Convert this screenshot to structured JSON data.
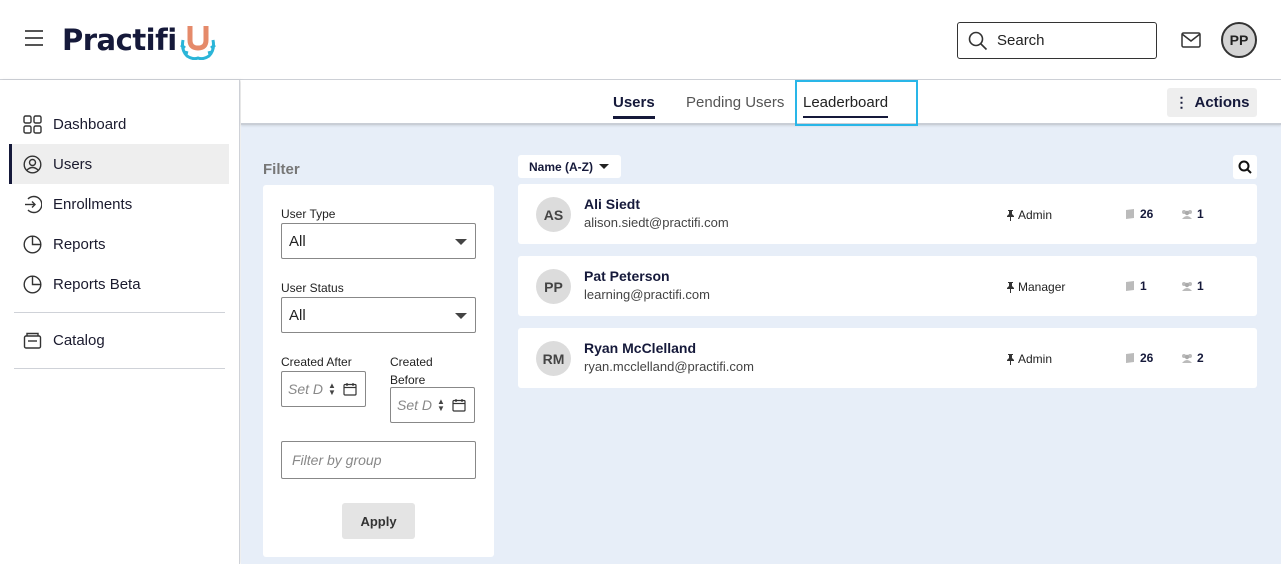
{
  "app": {
    "logo_text": "Practifi",
    "logo_letter": "U"
  },
  "header": {
    "search_placeholder": "Search",
    "avatar_initials": "PP"
  },
  "sidebar": {
    "items": [
      {
        "label": "Dashboard",
        "icon": "grid-icon"
      },
      {
        "label": "Users",
        "icon": "user-circle-icon",
        "active": true
      },
      {
        "label": "Enrollments",
        "icon": "enroll-icon"
      },
      {
        "label": "Reports",
        "icon": "pie-chart-icon"
      },
      {
        "label": "Reports Beta",
        "icon": "pie-chart-icon"
      },
      {
        "label": "Catalog",
        "icon": "catalog-icon"
      }
    ]
  },
  "tabs": [
    {
      "label": "Users",
      "active": true
    },
    {
      "label": "Pending Users"
    },
    {
      "label": "Leaderboard"
    }
  ],
  "actions_label": "Actions",
  "filter": {
    "title": "Filter",
    "user_type_label": "User Type",
    "user_type_value": "All",
    "user_status_label": "User Status",
    "user_status_value": "All",
    "created_after_label": "Created After",
    "created_before_label": "Created Before",
    "date_placeholder": "Set D",
    "group_placeholder": "Filter by group",
    "apply_label": "Apply"
  },
  "sort_label": "Name (A-Z)",
  "users": [
    {
      "initials": "AS",
      "name": "Ali Siedt",
      "email": "alison.siedt@practifi.com",
      "role": "Admin",
      "courses": "26",
      "groups": "1"
    },
    {
      "initials": "PP",
      "name": "Pat Peterson",
      "email": "learning@practifi.com",
      "role": "Manager",
      "courses": "1",
      "groups": "1"
    },
    {
      "initials": "RM",
      "name": "Ryan McClelland",
      "email": "ryan.mcclelland@practifi.com",
      "role": "Admin",
      "courses": "26",
      "groups": "2"
    }
  ],
  "colors": {
    "brand_navy": "#15193a",
    "logo_accent": "#e58a6a",
    "logo_leaf": "#2bb5d8",
    "focus_outline": "#29b6e8",
    "main_bg": "#e7eef8"
  }
}
